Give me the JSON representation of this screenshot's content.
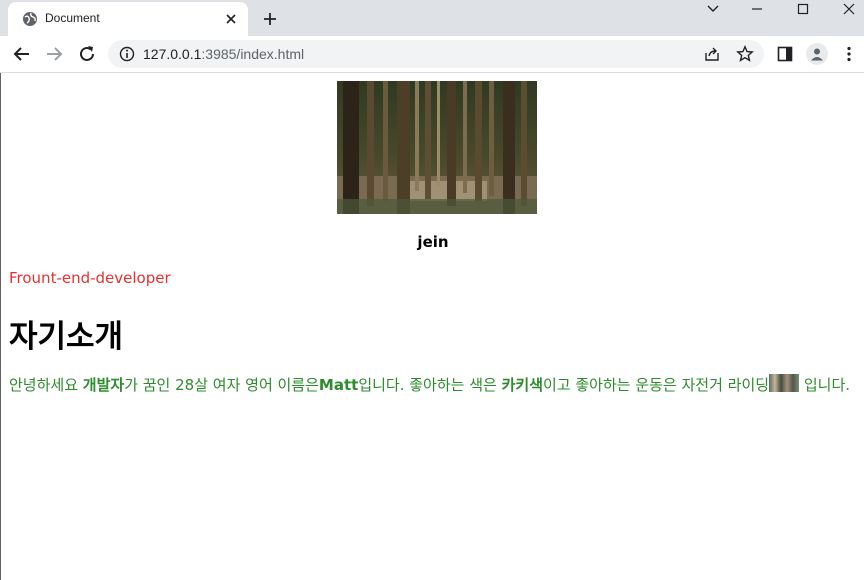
{
  "browser": {
    "tab_title": "Document",
    "url_host": "127.0.0.1",
    "url_port_path": ":3985/index.html"
  },
  "page": {
    "name": "jein",
    "role": "Frount-end-developer",
    "heading": "자기소개",
    "intro": {
      "p1": "안녕하세요 ",
      "b1": "개발자",
      "p2": "가 꿈인 28살 여자 영어 이름은",
      "b2": "Matt",
      "p3": "입니다. 좋아하는 색은 ",
      "b3": "카키색",
      "p4": "이고 좋아하는 운동은 자전거 라이딩",
      "p5": " 입니다."
    }
  },
  "colors": {
    "role_text": "#e8312f",
    "intro_text": "#2e8b2e"
  },
  "icons": [
    "globe-icon",
    "close-icon",
    "plus-icon",
    "minimize-icon",
    "maximize-icon",
    "window-close-icon",
    "chevron-down-icon",
    "back-arrow-icon",
    "forward-arrow-icon",
    "reload-icon",
    "info-icon",
    "share-icon",
    "star-icon",
    "side-panel-icon",
    "profile-icon",
    "menu-icon"
  ]
}
